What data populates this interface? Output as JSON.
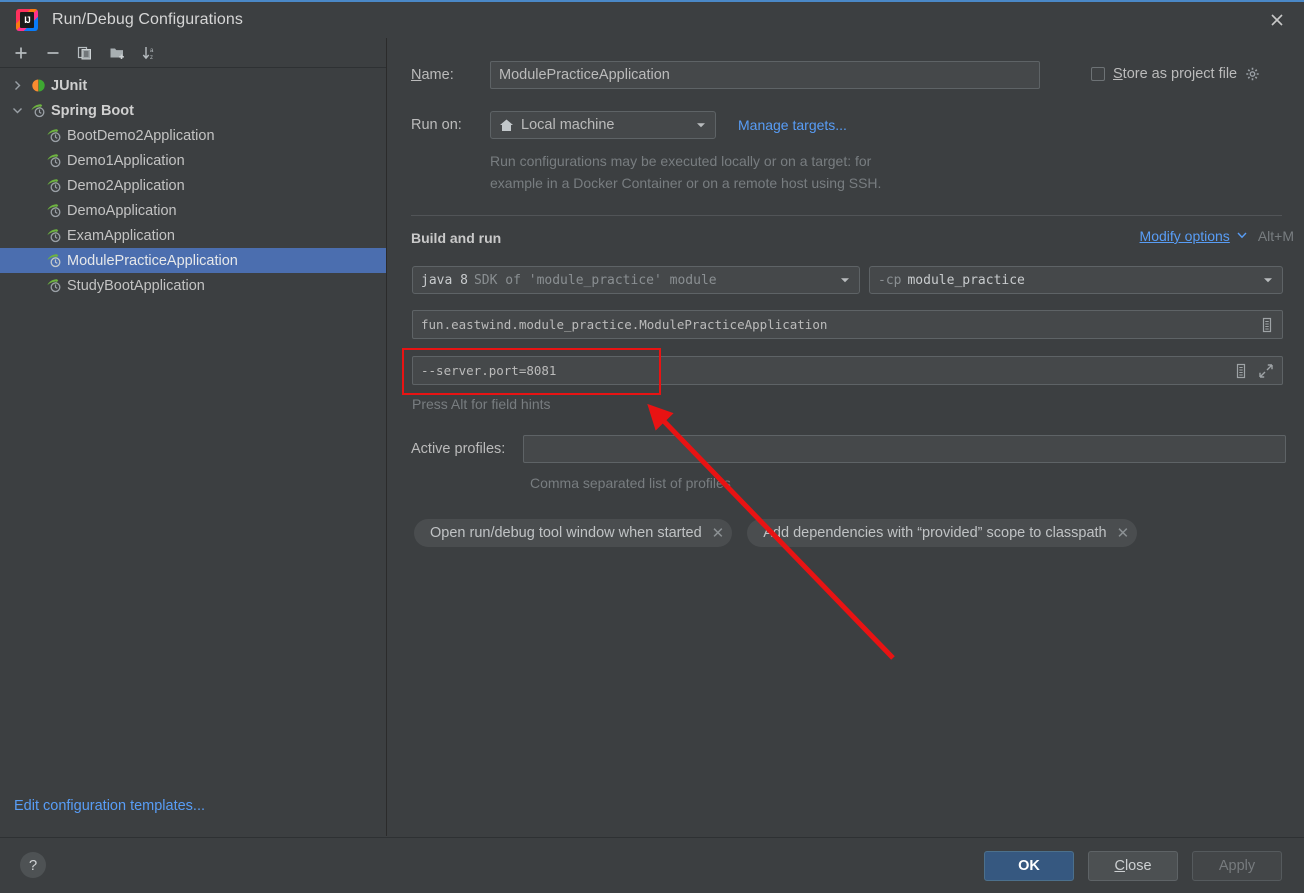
{
  "window": {
    "title": "Run/Debug Configurations",
    "close_icon": "close-icon",
    "app_logo": "intellij-idea-logo"
  },
  "sidebar": {
    "toolbar": [
      {
        "name": "add-configuration-button",
        "icon": "plus-icon",
        "label": "+"
      },
      {
        "name": "remove-configuration-button",
        "icon": "minus-icon",
        "label": "−"
      },
      {
        "name": "copy-configuration-button",
        "icon": "copy-icon",
        "label": ""
      },
      {
        "name": "new-folder-button",
        "icon": "new-folder-icon",
        "label": ""
      },
      {
        "name": "sort-configurations-button",
        "icon": "sort-alphabetically-icon",
        "label": ""
      }
    ],
    "tree": [
      {
        "label": "JUnit",
        "type": "group",
        "expanded": false,
        "icon": "junit-icon",
        "selected": false
      },
      {
        "label": "Spring Boot",
        "type": "group",
        "expanded": true,
        "icon": "spring-boot-icon",
        "selected": false
      },
      {
        "label": "BootDemo2Application",
        "type": "child",
        "icon": "spring-boot-icon",
        "selected": false
      },
      {
        "label": "Demo1Application",
        "type": "child",
        "icon": "spring-boot-icon",
        "selected": false
      },
      {
        "label": "Demo2Application",
        "type": "child",
        "icon": "spring-boot-icon",
        "selected": false
      },
      {
        "label": "DemoApplication",
        "type": "child",
        "icon": "spring-boot-icon",
        "selected": false
      },
      {
        "label": "ExamApplication",
        "type": "child",
        "icon": "spring-boot-icon",
        "selected": false
      },
      {
        "label": "ModulePracticeApplication",
        "type": "child",
        "icon": "spring-boot-icon",
        "selected": true
      },
      {
        "label": "StudyBootApplication",
        "type": "child",
        "icon": "spring-boot-icon",
        "selected": false
      }
    ],
    "edit_templates_link": "Edit configuration templates..."
  },
  "form": {
    "name_label": "Name:",
    "name_label_mnemonic": "N",
    "name_value": "ModulePracticeApplication",
    "store_as_project_file_label": "Store as project file",
    "store_as_project_file_mnemonic": "S",
    "store_as_project_file_checked": false,
    "store_settings_icon": "gear-icon",
    "run_on_label": "Run on:",
    "run_on_value": "Local machine",
    "run_on_icon": "home-icon",
    "manage_targets_link": "Manage targets...",
    "run_on_description_line1": "Run configurations may be executed locally or on a target: for",
    "run_on_description_line2": "example in a Docker Container or on a remote host using SSH.",
    "build_and_run_title": "Build and run",
    "modify_options_link": "Modify options",
    "modify_options_mnemonic": "M",
    "modify_options_shortcut": "Alt+M",
    "jre_value_bright": "java 8",
    "jre_value_dim": "SDK of 'module_practice' module",
    "classpath_value_dim": "-cp",
    "classpath_value_bright": "module_practice",
    "main_class_value": "fun.eastwind.module_practice.ModulePracticeApplication",
    "main_class_browse_icon": "browse-class-icon",
    "program_arguments_value": "--server.port=8081",
    "program_arguments_macro_icon": "insert-macro-icon",
    "program_arguments_expand_icon": "expand-editor-icon",
    "field_hints_text": "Press Alt for field hints",
    "active_profiles_label": "Active profiles:",
    "active_profiles_value": "",
    "active_profiles_hint": "Comma separated list of profiles",
    "chips": [
      {
        "label": "Open run/debug tool window when started",
        "close_icon": "close-icon"
      },
      {
        "label": "Add dependencies with “provided” scope to classpath",
        "close_icon": "close-icon"
      }
    ]
  },
  "footer": {
    "help_icon": "help-icon",
    "help_label": "?",
    "ok_label": "OK",
    "close_label": "Close",
    "close_mnemonic": "C",
    "apply_label": "Apply",
    "apply_enabled": false
  },
  "annotations": {
    "highlight_rect_color": "#e81313",
    "arrow_color": "#e81313",
    "arrow_tip": "648,405",
    "arrow_tail": "893,658"
  },
  "colors": {
    "background": "#3c3f41",
    "selection": "#4b6eaf",
    "link": "#589df6",
    "primary_button": "#365880",
    "accent_title_border": "#4a88c7"
  }
}
